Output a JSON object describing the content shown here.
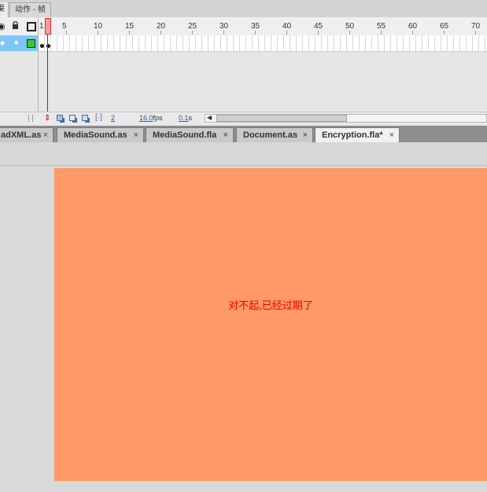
{
  "panel_tabs": {
    "left_partial": "渠",
    "actions_frame": "动作 - 帧"
  },
  "timeline": {
    "ruler": [
      "1",
      "5",
      "10",
      "15",
      "20",
      "25",
      "30",
      "35",
      "40",
      "45",
      "50",
      "55",
      "60",
      "65",
      "70"
    ],
    "footer": {
      "current_frame": "2",
      "fps_value": "16.0",
      "fps_unit": "fps",
      "time_value": "0.1",
      "time_unit": "s"
    }
  },
  "document_tabs": [
    {
      "label": "adXML.as",
      "close": "×"
    },
    {
      "label": "MediaSound.as",
      "close": "×"
    },
    {
      "label": "MediaSound.fla",
      "close": "×"
    },
    {
      "label": "Document.as",
      "close": "×"
    },
    {
      "label": "Encryption.fla*",
      "close": "×",
      "active": true
    }
  ],
  "stage": {
    "message": "对不起,已经过期了",
    "background": "#ff9966",
    "text_color": "#ee0000"
  }
}
